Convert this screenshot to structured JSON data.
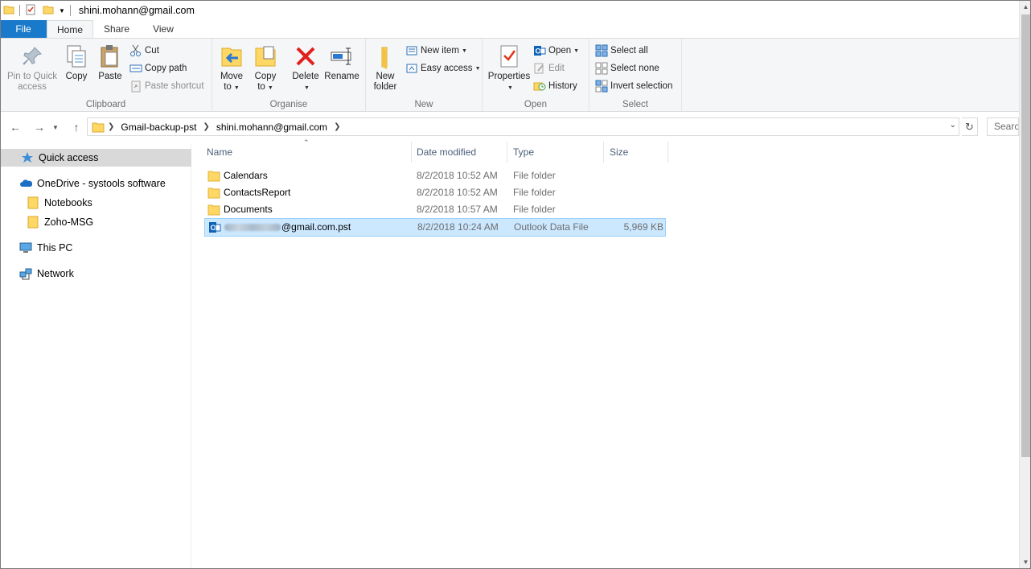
{
  "window": {
    "title": "shini.mohann@gmail.com"
  },
  "tabs": [
    {
      "label": "File"
    },
    {
      "label": "Home"
    },
    {
      "label": "Share"
    },
    {
      "label": "View"
    }
  ],
  "ribbon": {
    "clipboard": {
      "label": "Clipboard",
      "pin_line1": "Pin to Quick",
      "pin_line2": "access",
      "copy": "Copy",
      "paste": "Paste",
      "cut": "Cut",
      "copy_path": "Copy path",
      "paste_shortcut": "Paste shortcut"
    },
    "organise": {
      "label": "Organise",
      "move_line1": "Move",
      "move_line2": "to",
      "copy_line1": "Copy",
      "copy_line2": "to",
      "delete": "Delete",
      "rename": "Rename"
    },
    "new": {
      "label": "New",
      "new_folder_line1": "New",
      "new_folder_line2": "folder",
      "new_item": "New item",
      "easy_access": "Easy access"
    },
    "open": {
      "label": "Open",
      "properties": "Properties",
      "open": "Open",
      "edit": "Edit",
      "history": "History"
    },
    "select": {
      "label": "Select",
      "select_all": "Select all",
      "select_none": "Select none",
      "invert_selection": "Invert selection"
    }
  },
  "address": {
    "crumbs": [
      "Gmail-backup-pst",
      "shini.mohann@gmail.com"
    ],
    "search_placeholder": "Search shini.mohann@gmail.com"
  },
  "navpane": {
    "quick_access": "Quick access",
    "onedrive": "OneDrive - systools software",
    "notebooks": "Notebooks",
    "zoho": "Zoho-MSG",
    "this_pc": "This PC",
    "network": "Network"
  },
  "columns": {
    "name": "Name",
    "date": "Date modified",
    "type": "Type",
    "size": "Size"
  },
  "files": [
    {
      "name": "Calendars",
      "date": "8/2/2018 10:52 AM",
      "type": "File folder",
      "size": ""
    },
    {
      "name": "ContactsReport",
      "date": "8/2/2018 10:52 AM",
      "type": "File folder",
      "size": ""
    },
    {
      "name": "Documents",
      "date": "8/2/2018 10:57 AM",
      "type": "File folder",
      "size": ""
    },
    {
      "name": "@gmail.com.pst",
      "date": "8/2/2018 10:24 AM",
      "type": "Outlook Data File",
      "size": "5,969 KB"
    }
  ],
  "colors": {
    "file_tab": "#1979ca",
    "selection_bg": "#cce8ff",
    "selection_border": "#99d1ff",
    "folder_yellow": "#ffd765"
  }
}
